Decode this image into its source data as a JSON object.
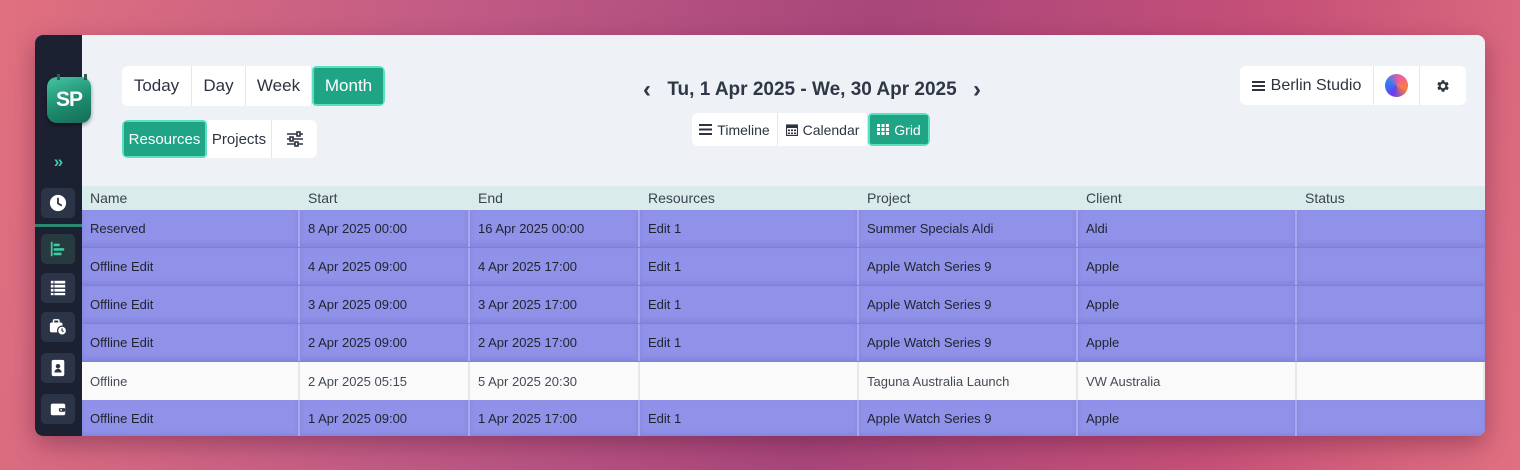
{
  "sidebar": {
    "logo_text": "SP",
    "icons": [
      "expand-icon",
      "clock-icon",
      "timeline-icon",
      "list-icon",
      "briefcase-clock-icon",
      "contact-card-icon",
      "wallet-icon"
    ]
  },
  "view_toggle": {
    "today": "Today",
    "day": "Day",
    "week": "Week",
    "month": "Month",
    "active": "Month"
  },
  "mode_toggle": {
    "resources": "Resources",
    "projects": "Projects",
    "active": "Resources"
  },
  "date_range": {
    "label": "Tu, 1 Apr 2025 - We, 30 Apr 2025",
    "prev": "‹",
    "next": "›"
  },
  "layout_toggle": {
    "timeline": "Timeline",
    "calendar": "Calendar",
    "grid": "Grid",
    "active": "Grid"
  },
  "studio": {
    "label": "Berlin Studio"
  },
  "colors": {
    "accent": "#1fa486",
    "row_highlight": "#9091e8",
    "sidebar_bg": "#1b2130"
  },
  "table": {
    "headers": [
      "Name",
      "Start",
      "End",
      "Resources",
      "Project",
      "Client",
      "Status"
    ],
    "rows": [
      {
        "name": "Reserved",
        "start": "8 Apr 2025 00:00",
        "end": "16 Apr 2025 00:00",
        "resources": "Edit 1",
        "project": "Summer Specials Aldi",
        "client": "Aldi",
        "status": "",
        "style": "purple"
      },
      {
        "name": "Offline Edit",
        "start": "4 Apr 2025 09:00",
        "end": "4 Apr 2025 17:00",
        "resources": "Edit 1",
        "project": "Apple Watch Series 9",
        "client": "Apple",
        "status": "",
        "style": "purple"
      },
      {
        "name": "Offline Edit",
        "start": "3 Apr 2025 09:00",
        "end": "3 Apr 2025 17:00",
        "resources": "Edit 1",
        "project": "Apple Watch Series 9",
        "client": "Apple",
        "status": "",
        "style": "purple"
      },
      {
        "name": "Offline Edit",
        "start": "2 Apr 2025 09:00",
        "end": "2 Apr 2025 17:00",
        "resources": "Edit 1",
        "project": "Apple Watch Series 9",
        "client": "Apple",
        "status": "",
        "style": "purple"
      },
      {
        "name": "Offline",
        "start": "2 Apr 2025 05:15",
        "end": "5 Apr 2025 20:30",
        "resources": "",
        "project": "Taguna Australia Launch",
        "client": "VW Australia",
        "status": "",
        "style": "white"
      },
      {
        "name": "Offline Edit",
        "start": "1 Apr 2025 09:00",
        "end": "1 Apr 2025 17:00",
        "resources": "Edit 1",
        "project": "Apple Watch Series 9",
        "client": "Apple",
        "status": "",
        "style": "purple"
      }
    ]
  }
}
